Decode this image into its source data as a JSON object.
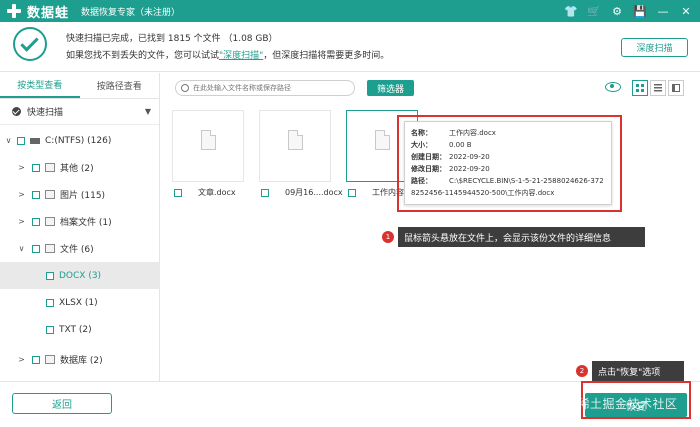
{
  "titlebar": {
    "app_name": "数据蛙",
    "subtitle": "数据恢复专家（未注册）",
    "icons": [
      "tshirt-icon",
      "cart-icon",
      "gear-icon",
      "save-icon",
      "minimize-icon",
      "close-icon"
    ],
    "icon_glyphs": [
      "👕",
      "🛒",
      "⚙",
      "💾",
      "—",
      "✕"
    ]
  },
  "scan_info": {
    "line1": "快速扫描已完成，已找到  1815  个文件 （1.08 GB）",
    "line2_prefix": "如果您找不到丢失的文件，您可以试试",
    "line2_link": "\"深度扫描\"",
    "line2_suffix": "，但深度扫描将需要更多时间。",
    "deep_scan_button": "深度扫描"
  },
  "sidebar": {
    "tabs": [
      "按类型查看",
      "按路径查看"
    ],
    "quick_scan_label": "快速扫描",
    "quick_scan_caret": "▼",
    "tree": [
      {
        "caret": "∨",
        "label": "C:(NTFS) (126)",
        "icon": "drive-icon",
        "indent": 0
      },
      {
        "caret": ">",
        "label": "其他 (2)",
        "icon": "folder-icon",
        "indent": 1
      },
      {
        "caret": ">",
        "label": "图片 (115)",
        "icon": "image-icon",
        "indent": 1
      },
      {
        "caret": ">",
        "label": "档案文件 (1)",
        "icon": "archive-icon",
        "indent": 1
      },
      {
        "caret": "∨",
        "label": "文件 (6)",
        "icon": "document-icon",
        "indent": 1
      },
      {
        "caret": "",
        "label": "DOCX (3)",
        "icon": "",
        "indent": 2,
        "selected": true
      },
      {
        "caret": "",
        "label": "XLSX (1)",
        "icon": "",
        "indent": 2
      },
      {
        "caret": "",
        "label": "TXT (2)",
        "icon": "",
        "indent": 2
      },
      {
        "caret": ">",
        "label": "数据库 (2)",
        "icon": "database-icon",
        "indent": 1
      }
    ]
  },
  "toolbar": {
    "search_placeholder": "在此处输入文件名称或保存路径",
    "filter_button": "筛选器"
  },
  "files": [
    {
      "name": "文章.docx"
    },
    {
      "name": "09月16....docx"
    },
    {
      "name": "工作内容.do"
    }
  ],
  "tooltip": {
    "name_key": "名称：",
    "name_val": "工作内容.docx",
    "size_key": "大小：",
    "size_val": "0.00 B",
    "created_key": "创建日期：",
    "created_val": "2022-09-20",
    "modified_key": "修改日期：",
    "modified_val": "2022-09-20",
    "path_key": "路径：",
    "path_val": "C:\\$RECYCLE.BIN\\S-1-5-21-2588024626-3728252456-1145944520-500\\工作内容.docx"
  },
  "annotations": {
    "badge1": "1",
    "note1": "鼠标箭头悬放在文件上，会显示该份文件的详细信息",
    "badge2": "2",
    "note2": "点击\"恢复\"选项"
  },
  "bottom": {
    "back_button": "返回",
    "recover_button": "恢复",
    "watermark": "@稀土掘金技术社区"
  },
  "colors": {
    "accent": "#1d9e8e",
    "highlight_red": "#d9332f"
  }
}
